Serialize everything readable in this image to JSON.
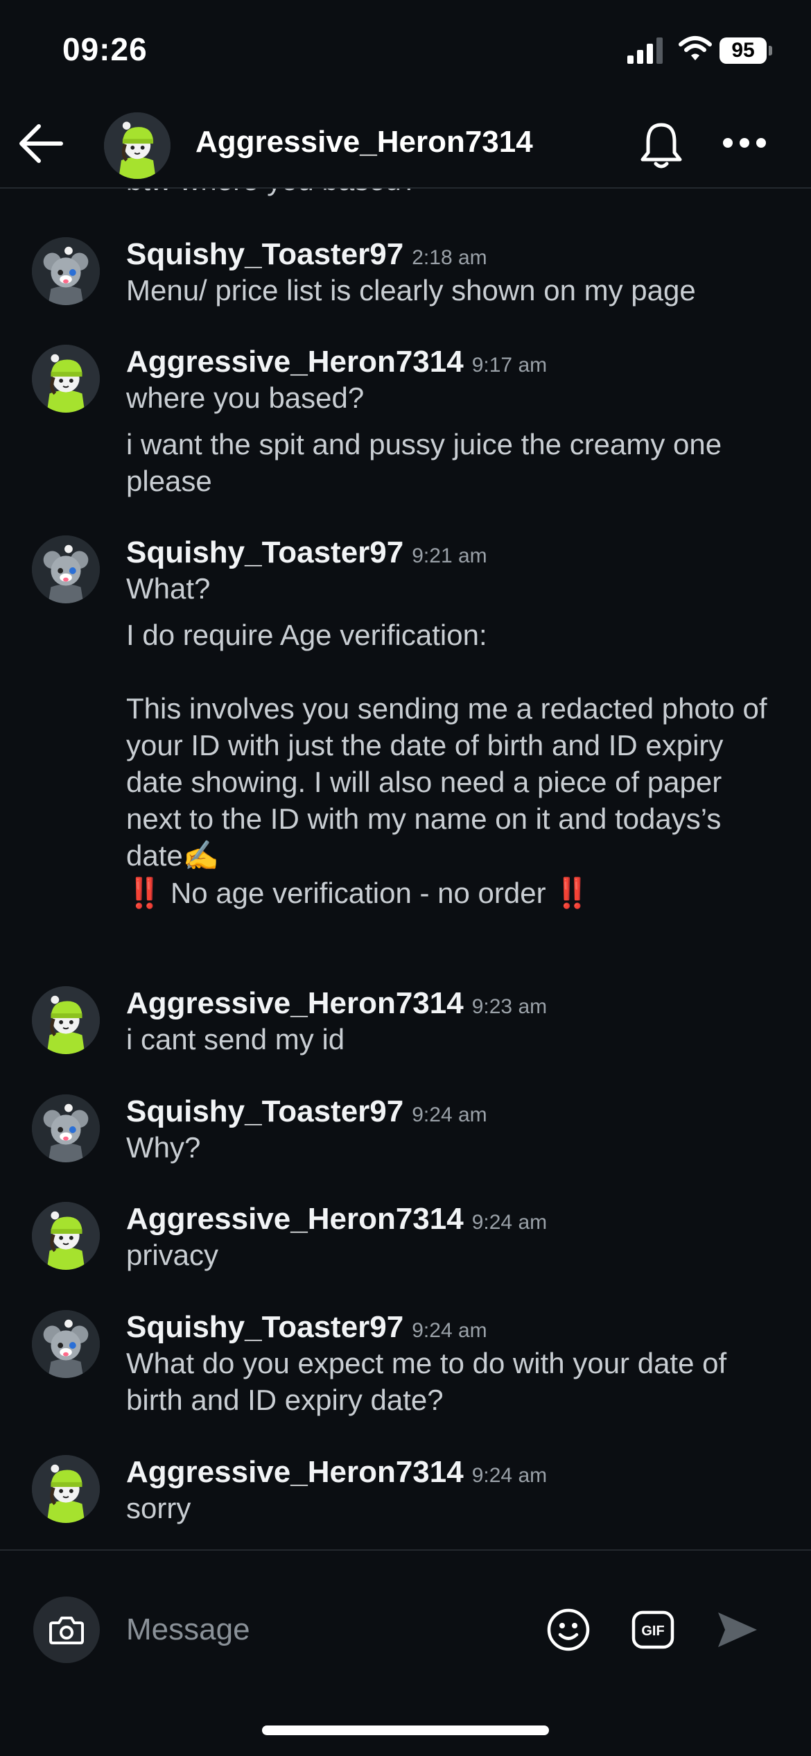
{
  "status_bar": {
    "time": "09:26",
    "battery": "95"
  },
  "header": {
    "title": "Aggressive_Heron7314"
  },
  "chat": {
    "cutoff_text": "btw where you based?",
    "messages": [
      {
        "user": "Squishy_Toaster97",
        "time": "2:18 am",
        "lines": [
          "Menu/ price list is clearly shown on my page"
        ]
      },
      {
        "user": "Aggressive_Heron7314",
        "time": "9:17 am",
        "lines": [
          "where you based?",
          "i want the spit and pussy juice the creamy one please"
        ]
      },
      {
        "user": "Squishy_Toaster97",
        "time": "9:21 am",
        "lines": [
          "What?",
          "I do require Age verification:",
          "This involves you sending me a redacted photo of your ID with just the date of birth and ID expiry date showing. I will also need a piece of paper next to the ID with my name on it and todays’s date✍️",
          "No age verification - no order"
        ],
        "warn_mark": "‼️"
      },
      {
        "user": "Aggressive_Heron7314",
        "time": "9:23 am",
        "lines": [
          "i cant send my id"
        ]
      },
      {
        "user": "Squishy_Toaster97",
        "time": "9:24 am",
        "lines": [
          "Why?"
        ]
      },
      {
        "user": "Aggressive_Heron7314",
        "time": "9:24 am",
        "lines": [
          "privacy"
        ]
      },
      {
        "user": "Squishy_Toaster97",
        "time": "9:24 am",
        "lines": [
          "What do you expect me to do with your date of birth and ID expiry date?"
        ]
      },
      {
        "user": "Aggressive_Heron7314",
        "time": "9:24 am",
        "lines": [
          "sorry"
        ]
      }
    ]
  },
  "composer": {
    "placeholder": "Message",
    "gif_label": "GIF"
  },
  "colors": {
    "background": "#0b0e12",
    "divider": "#24292e",
    "warn": "#e0262b",
    "heron_accent": "#a6e22e"
  }
}
